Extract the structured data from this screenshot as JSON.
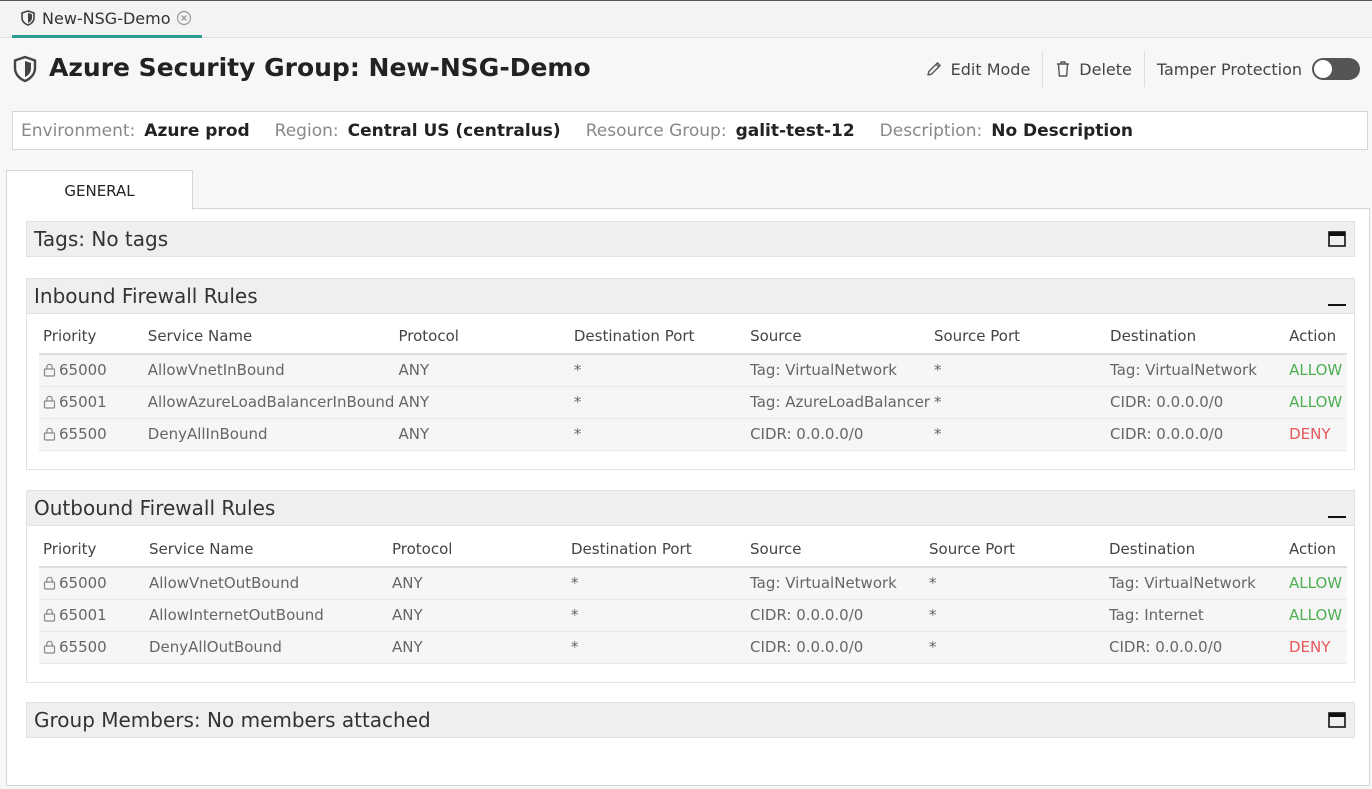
{
  "tab": {
    "title": "New-NSG-Demo"
  },
  "header": {
    "title": "Azure Security Group: New-NSG-Demo",
    "edit_label": "Edit Mode",
    "delete_label": "Delete",
    "tamper_label": "Tamper Protection",
    "tamper_on": false
  },
  "info": {
    "env_label": "Environment:",
    "env_value": "Azure prod",
    "region_label": "Region:",
    "region_value": "Central US (centralus)",
    "rg_label": "Resource Group:",
    "rg_value": "galit-test-12",
    "desc_label": "Description:",
    "desc_value": "No Description"
  },
  "tabs": {
    "general": "GENERAL"
  },
  "tags": {
    "title": "Tags: No tags"
  },
  "columns": [
    "Priority",
    "Service Name",
    "Protocol",
    "Destination Port",
    "Source",
    "Source Port",
    "Destination",
    "Action"
  ],
  "inbound": {
    "title": "Inbound Firewall Rules",
    "rows": [
      [
        "65000",
        "AllowVnetInBound",
        "ANY",
        "*",
        "Tag: VirtualNetwork",
        "*",
        "Tag: VirtualNetwork",
        "ALLOW"
      ],
      [
        "65001",
        "AllowAzureLoadBalancerInBound",
        "ANY",
        "*",
        "Tag: AzureLoadBalancer",
        "*",
        "CIDR: 0.0.0.0/0",
        "ALLOW"
      ],
      [
        "65500",
        "DenyAllInBound",
        "ANY",
        "*",
        "CIDR: 0.0.0.0/0",
        "*",
        "CIDR: 0.0.0.0/0",
        "DENY"
      ]
    ]
  },
  "outbound": {
    "title": "Outbound Firewall Rules",
    "rows": [
      [
        "65000",
        "AllowVnetOutBound",
        "ANY",
        "*",
        "Tag: VirtualNetwork",
        "*",
        "Tag: VirtualNetwork",
        "ALLOW"
      ],
      [
        "65001",
        "AllowInternetOutBound",
        "ANY",
        "*",
        "CIDR: 0.0.0.0/0",
        "*",
        "Tag: Internet",
        "ALLOW"
      ],
      [
        "65500",
        "DenyAllOutBound",
        "ANY",
        "*",
        "CIDR: 0.0.0.0/0",
        "*",
        "CIDR: 0.0.0.0/0",
        "DENY"
      ]
    ]
  },
  "members": {
    "title": "Group Members: No members attached"
  },
  "colors": {
    "accent": "#2e9c8f",
    "allow": "#4caf50",
    "deny": "#e8575b"
  }
}
